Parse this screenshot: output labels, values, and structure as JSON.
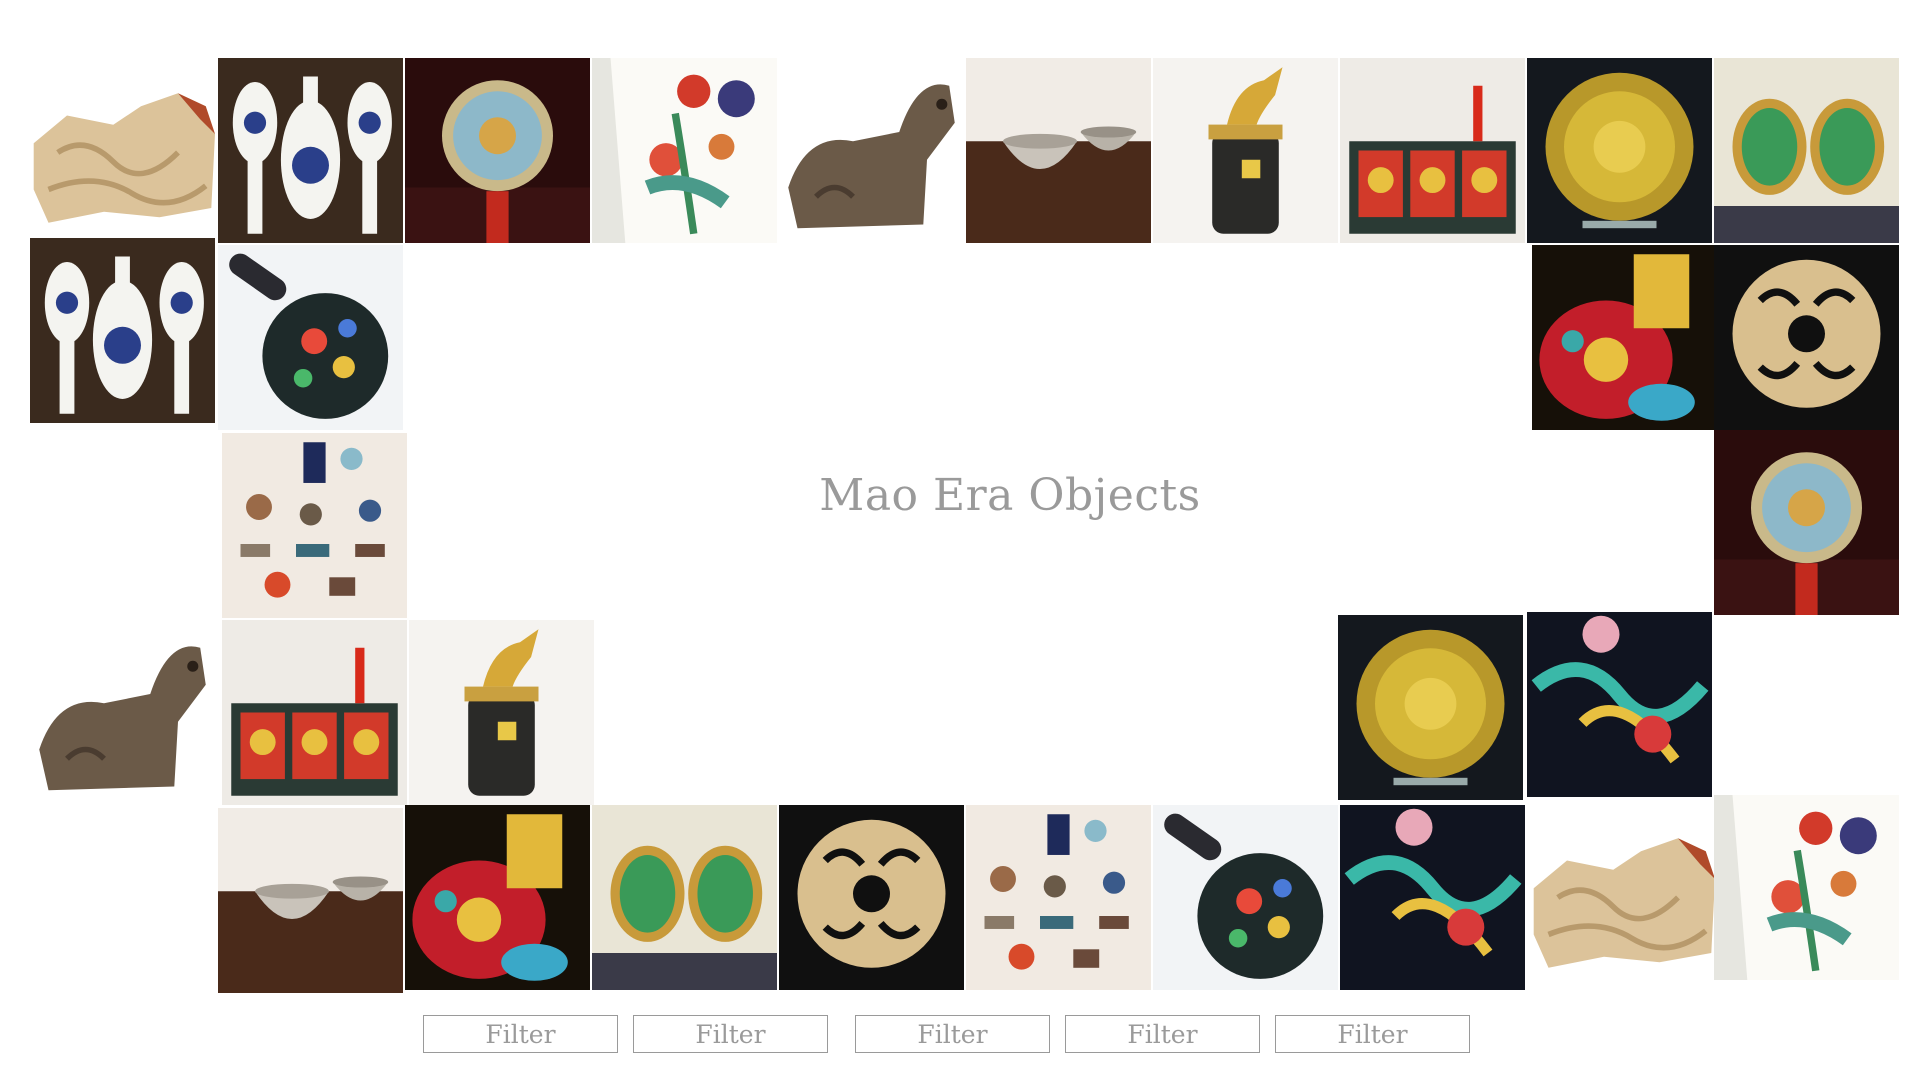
{
  "page": {
    "title": "Mao Era Objects"
  },
  "filters": [
    "Filter",
    "Filter",
    "Filter",
    "Filter",
    "Filter"
  ],
  "tiles": [
    {
      "id": "stone-carving",
      "icon": "stone-carving-icon"
    },
    {
      "id": "blue-white-spoons",
      "icon": "porcelain-spoons-icon"
    },
    {
      "id": "dragon-plaque",
      "icon": "dragon-plaque-icon"
    },
    {
      "id": "famille-flower-panel",
      "icon": "flower-panel-icon"
    },
    {
      "id": "bronze-ox",
      "icon": "bronze-ox-icon"
    },
    {
      "id": "celadon-bowls",
      "icon": "bowls-icon"
    },
    {
      "id": "goldfish-jar",
      "icon": "goldfish-jar-icon"
    },
    {
      "id": "painted-cabinet",
      "icon": "cabinet-icon"
    },
    {
      "id": "gilt-plate",
      "icon": "gilt-plate-icon"
    },
    {
      "id": "jade-cufflinks",
      "icon": "jade-cufflinks-icon"
    },
    {
      "id": "famille-rose-vase",
      "icon": "vase-icon"
    },
    {
      "id": "carved-jade-disc",
      "icon": "jade-disc-icon"
    },
    {
      "id": "miniature-objects",
      "icon": "miniatures-icon"
    },
    {
      "id": "cloisonne-box",
      "icon": "cloisonne-box-icon"
    },
    {
      "id": "embroidered-phoenix",
      "icon": "phoenix-embroidery-icon"
    }
  ]
}
